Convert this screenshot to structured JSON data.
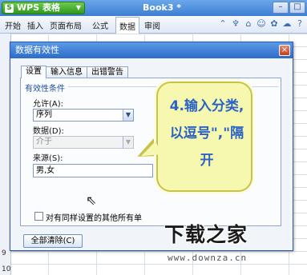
{
  "titlebar": {
    "app_button": "WPS 表格",
    "document_title": "Book3 *"
  },
  "menubar": {
    "items": [
      "开始",
      "插入",
      "页面布局",
      "公式",
      "数据",
      "审阅"
    ],
    "active_index": 4
  },
  "sheet": {
    "visible_row_numbers": [
      "9",
      "10"
    ]
  },
  "dialog": {
    "title": "数据有效性",
    "close_glyph": "×",
    "tabs": [
      "设置",
      "输入信息",
      "出错警告"
    ],
    "active_tab": 0,
    "section_title": "有效性条件",
    "allow": {
      "label": "允许(A):",
      "value": "序列"
    },
    "data": {
      "label": "数据(D):",
      "value": "介于",
      "disabled": true
    },
    "source": {
      "label": "来源(S):",
      "value": "男,女"
    },
    "apply_all_label": "对有同样设置的其他所有单",
    "clear_all_label": "全部清除(C)"
  },
  "callout": {
    "text": "4.输入分类,以逗号\",\"隔开",
    "colors": {
      "fill": "#f7f8b0",
      "border": "#c7c24a",
      "text": "#2a63c4"
    }
  },
  "watermark": {
    "logo_text": "下载之家",
    "url": "www.downza.cn"
  }
}
